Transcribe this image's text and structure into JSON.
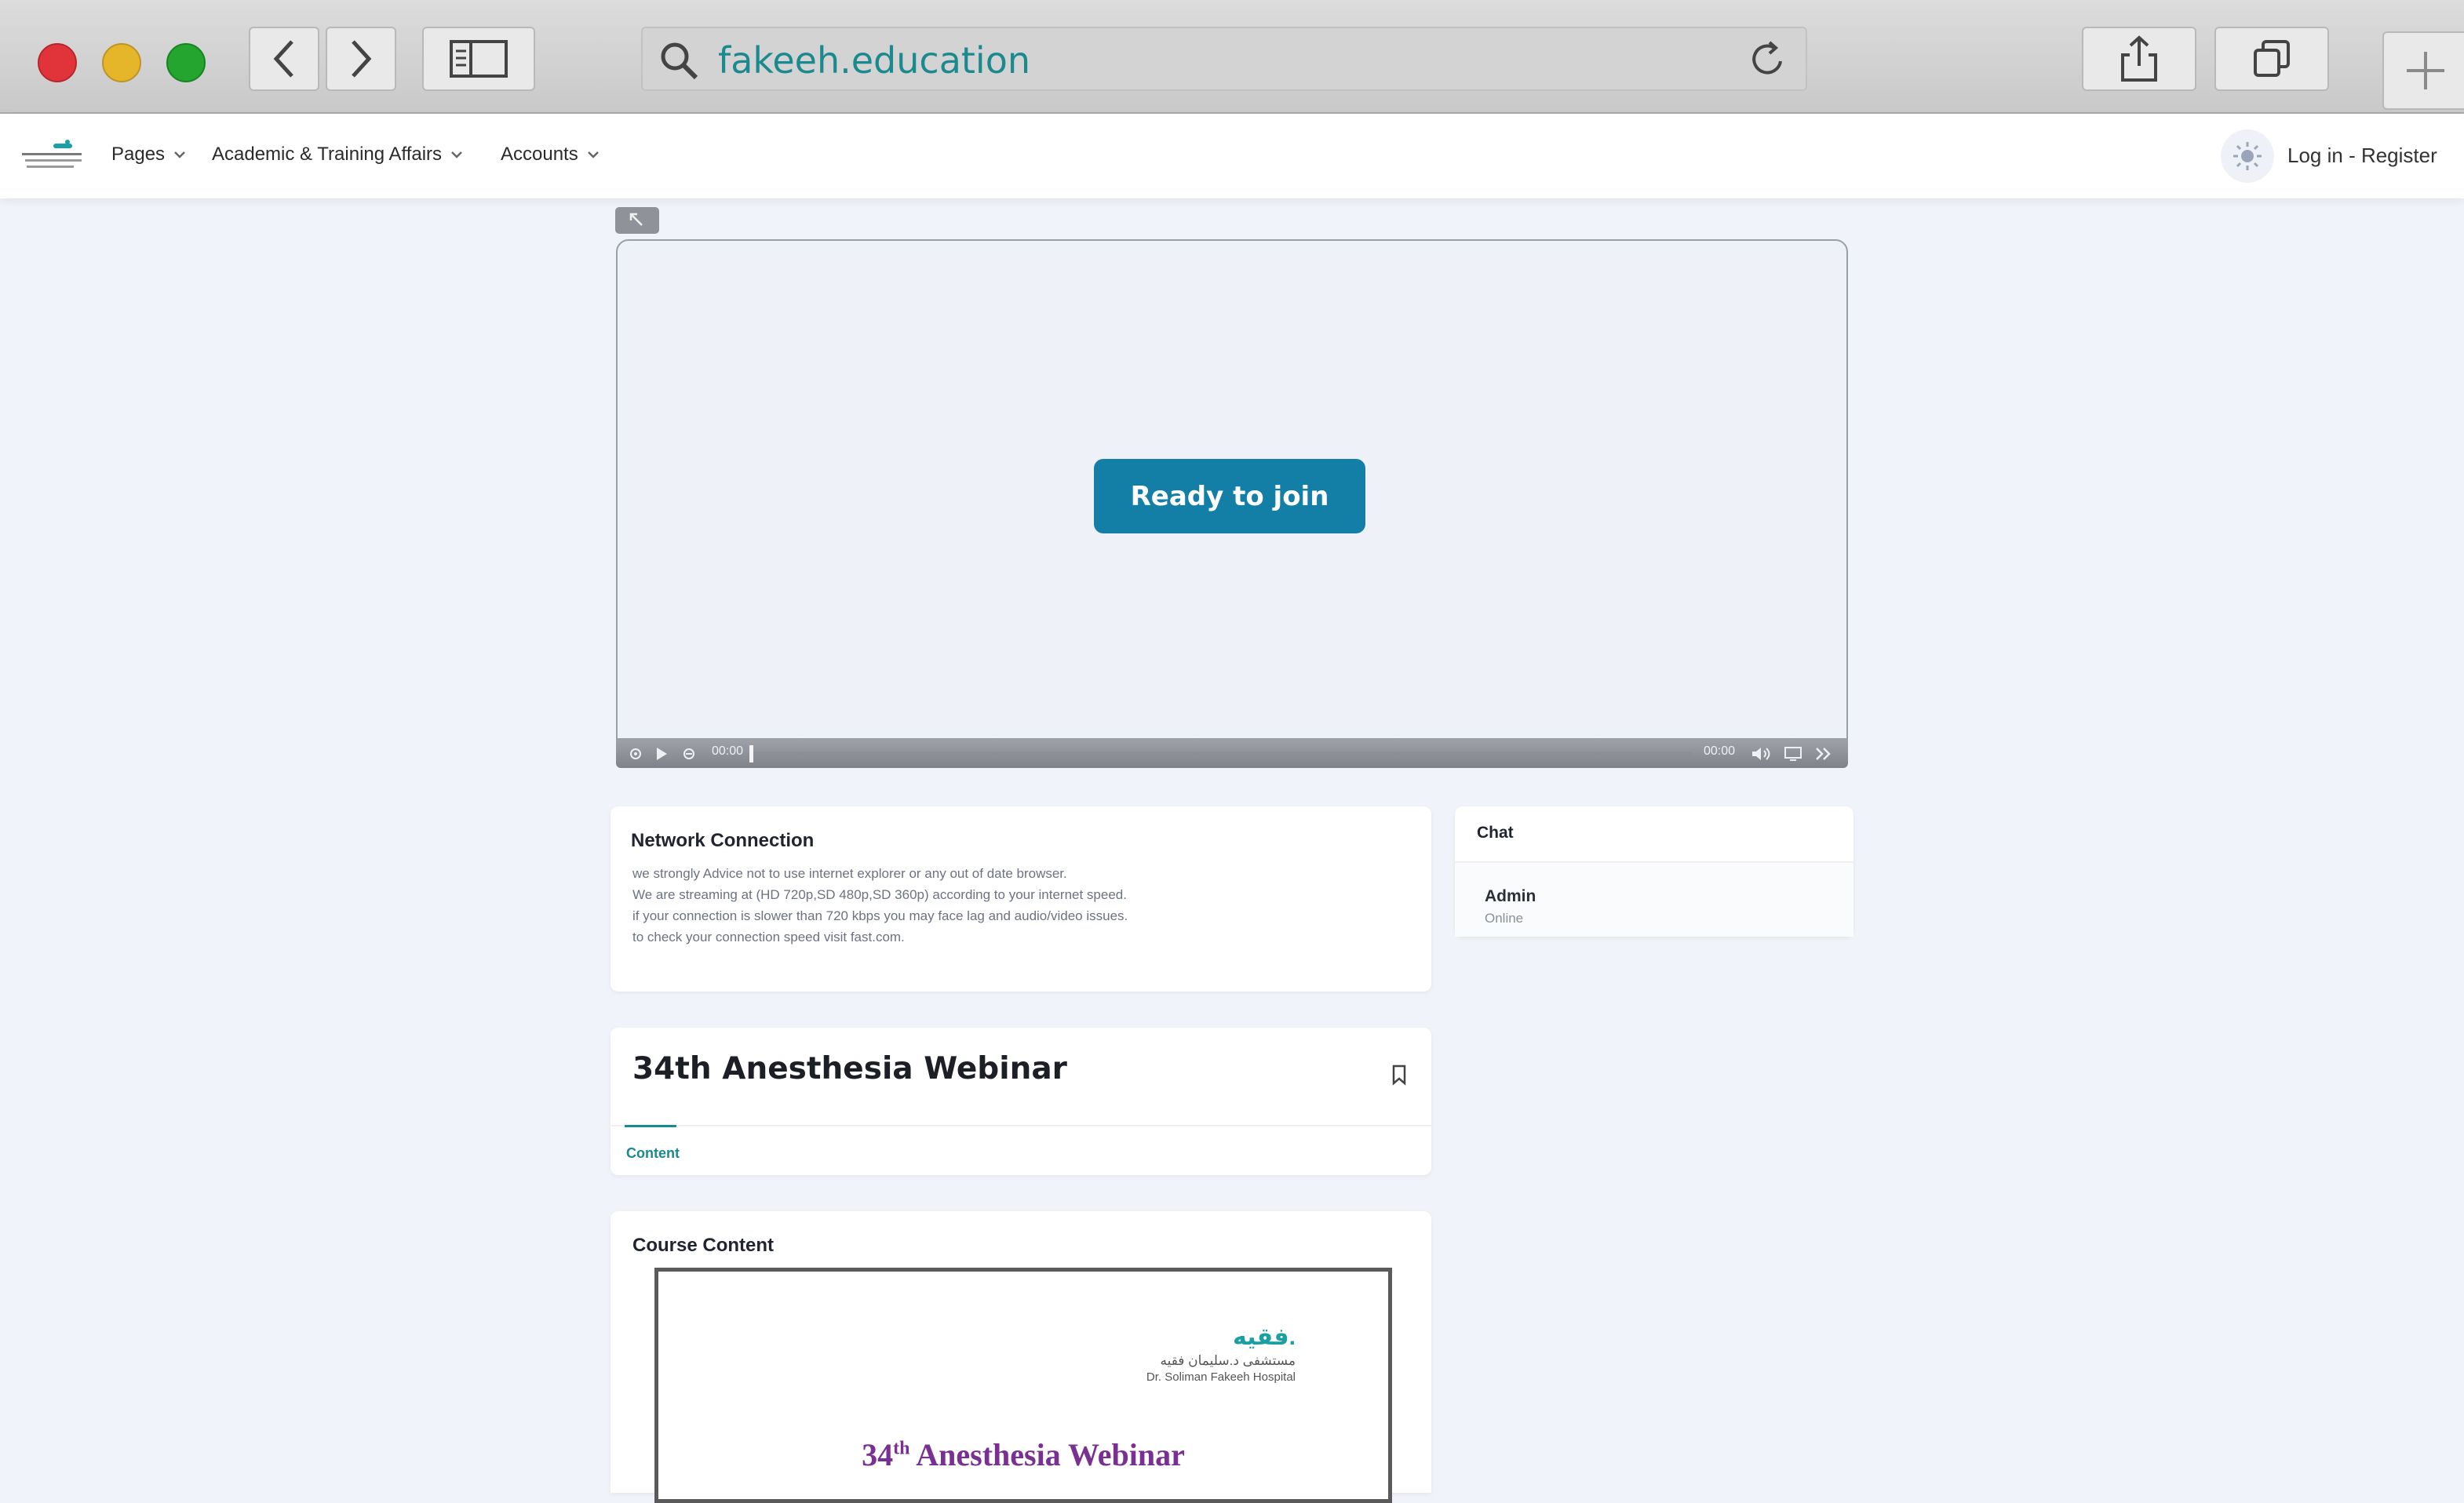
{
  "browser": {
    "url": "fakeeh.education",
    "buttons": [
      "back",
      "forward",
      "sidebar",
      "reload",
      "share",
      "tabs",
      "new-tab"
    ]
  },
  "nav": {
    "items": [
      {
        "label": "Pages"
      },
      {
        "label": "Academic & Training Affairs"
      },
      {
        "label": "Accounts"
      }
    ],
    "auth_label": "Log in - Register"
  },
  "player": {
    "join_label": "Ready to join",
    "time_current": "00:00",
    "time_total": "00:00"
  },
  "network": {
    "title": "Network Connection",
    "lines": [
      "we strongly Advice not to use internet explorer or any out of date browser.",
      "We are streaming at (HD 720p,SD 480p,SD 360p) according to your internet speed.",
      "if your connection is slower than 720 kbps you may face lag and audio/video issues.",
      "to check your connection speed visit fast.com."
    ]
  },
  "chat": {
    "title": "Chat",
    "user_name": "Admin",
    "user_status": "Online"
  },
  "course": {
    "title": "34th Anesthesia Webinar",
    "tab_label": "Content",
    "content_title": "Course Content",
    "doc": {
      "logo_text": "فقيه.",
      "hospital_ar": "مستشفى د.سليمان فقيه",
      "hospital_en": "Dr. Soliman Fakeeh Hospital",
      "title_prefix": "34",
      "title_sup": "th",
      "title_rest": " Anesthesia Webinar"
    }
  },
  "colors": {
    "accent": "#137fa6",
    "teal": "#1a8a8f",
    "background": "#f0f3fa"
  }
}
